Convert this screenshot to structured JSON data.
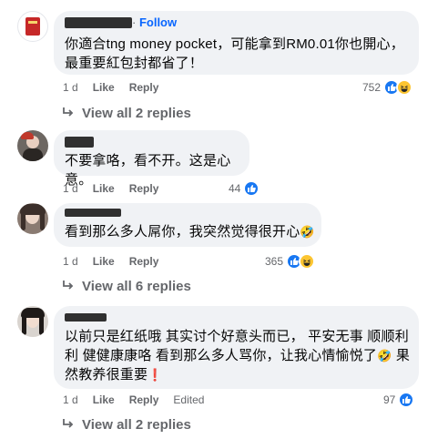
{
  "comments": [
    {
      "follow_sep": " · ",
      "follow_label": "Follow",
      "text_line1": "你適合tng money pocket，可能拿到RM0.01你也開心，",
      "text_line2": "最重要紅包封都省了！",
      "time": "1 d",
      "like_label": "Like",
      "reply_label": "Reply",
      "reaction_count": "752",
      "view_replies": "View all 2 replies"
    },
    {
      "text_line1": "不要拿咯，看不开。这是心意。",
      "time": "1 d",
      "like_label": "Like",
      "reply_label": "Reply",
      "reaction_count": "44"
    },
    {
      "text_line1": "看到那么多人屌你，我突然觉得很开心",
      "time": "1 d",
      "like_label": "Like",
      "reply_label": "Reply",
      "reaction_count": "365",
      "view_replies": "View all 6 replies"
    },
    {
      "text_line1": "以前只是红纸哦 其实讨个好意头而已， 平安无事 顺顺利",
      "text_line2": "利 健健康康咯 看到那么多人骂你，让我心情愉悦了",
      "text_line2b": " 果",
      "text_line3": "然教养很重要",
      "time": "1 d",
      "like_label": "Like",
      "reply_label": "Reply",
      "edited_label": "Edited",
      "reaction_count": "97",
      "view_replies": "View all 2 replies"
    }
  ],
  "icons": {
    "like": "like-reaction-icon",
    "haha": "haha-reaction-icon",
    "reply_arrow": "reply-arrow-icon",
    "emoji_rofl": "🤣",
    "emoji_exclaim": "❗"
  },
  "colors": {
    "bubble": "#f0f2f5",
    "like_blue": "#1877f2",
    "follow_blue": "#0866ff",
    "meta_gray": "#65676b"
  }
}
